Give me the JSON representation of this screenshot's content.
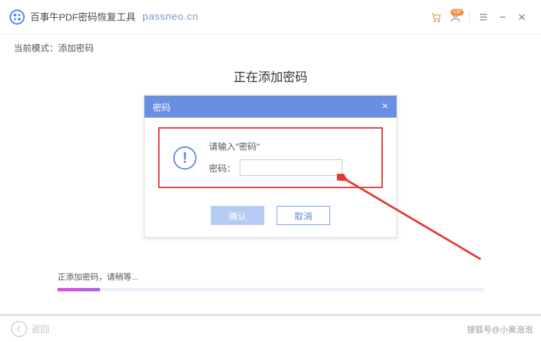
{
  "header": {
    "app_name": "百事牛PDF密码恢复工具",
    "domain": "passneo.cn",
    "user_badge": "VIP"
  },
  "mode": {
    "prefix": "当前模式：",
    "value": "添加密码"
  },
  "main": {
    "heading": "正在添加密码"
  },
  "dialog": {
    "title": "密码",
    "prompt": "请输入\"密码\"",
    "field_label": "密码：",
    "input_value": "",
    "confirm": "确认",
    "cancel": "取消"
  },
  "status": {
    "text": "正添加密码，请稍等...",
    "progress_pct": 10
  },
  "footer": {
    "back": "返回",
    "watermark": "搜狐号@小奥泡泡"
  }
}
